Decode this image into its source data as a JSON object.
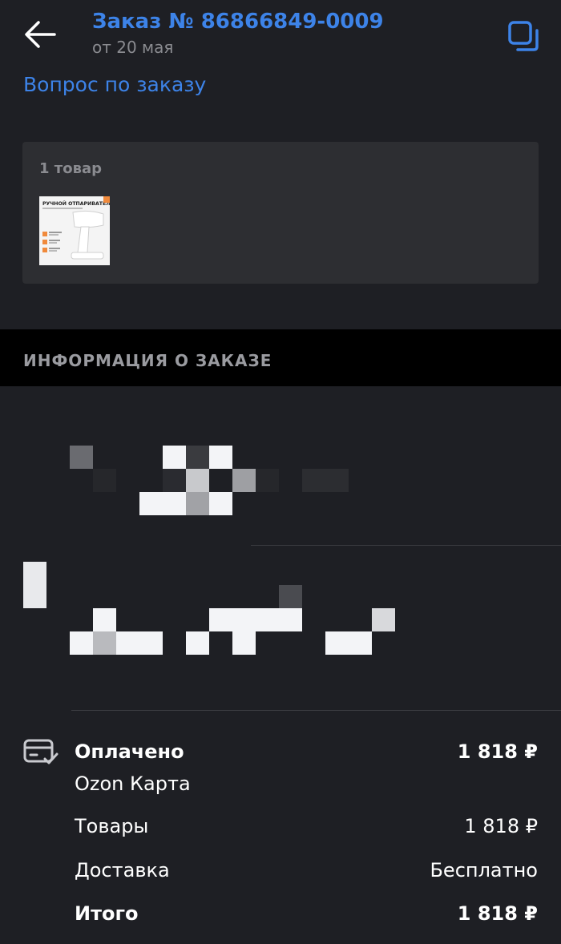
{
  "header": {
    "title": "Заказ № 86866849-0009",
    "subtitle": "от 20 мая",
    "back_icon": "arrow-left-icon",
    "copy_icon": "copy-icon",
    "accent_color": "#3d83e8"
  },
  "question_link": "Вопрос по заказу",
  "items_card": {
    "count_label": "1 товар",
    "product_image_text": {
      "headline": "РУЧНОЙ ОТПАРИВАТЕЛЬ"
    }
  },
  "order_info": {
    "section_title": "ИНФОРМАЦИЯ О ЗАКАЗЕ"
  },
  "payment": {
    "icon": "card-check-icon",
    "status_label": "Оплачено",
    "status_amount": "1 818 ₽",
    "method": "Ozon Карта",
    "rows": [
      {
        "label": "Товары",
        "value": "1 818 ₽"
      },
      {
        "label": "Доставка",
        "value": "Бесплатно"
      },
      {
        "label": "Итого",
        "value": "1 818 ₽"
      }
    ]
  }
}
